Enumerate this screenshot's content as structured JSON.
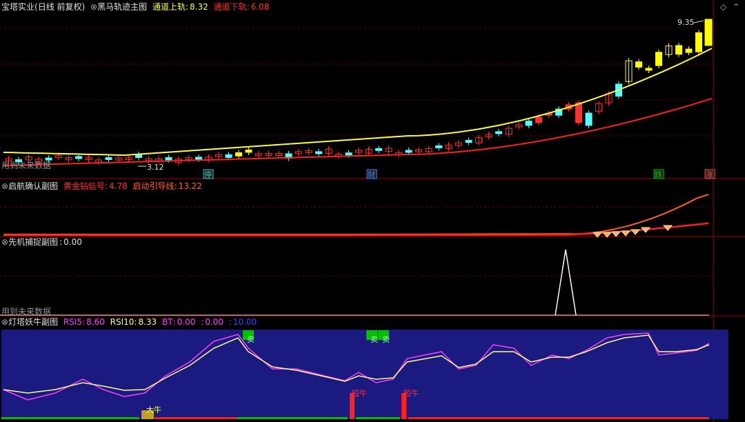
{
  "main_panel": {
    "stock_name": "宝塔实业",
    "period": "(日线 前复权)",
    "indicator_name": "黑马轨迹主图",
    "upper_label": "通道上轨",
    "upper_value": "8.32",
    "lower_label": "通道下轨",
    "lower_value": "6.08",
    "high_label": "9.35",
    "low_label": "3.12",
    "future_data_note": "用到未来数据",
    "markers": [
      {
        "text": "停",
        "color": "#40c0c0"
      },
      {
        "text": "财",
        "color": "#4080ff"
      },
      {
        "text": "跌",
        "color": "#00c000"
      },
      {
        "text": "涨",
        "color": "#ff4040"
      }
    ]
  },
  "panel2": {
    "title": "启航确认副图",
    "gold_label": "黄金钻信号",
    "gold_value": "4.78",
    "guide_label": "启动引导线",
    "guide_value": "13.22"
  },
  "panel3": {
    "title": "先机捕捉副图",
    "value": "0.00",
    "future_data_note": "用到未来数据"
  },
  "panel4": {
    "title": "灯塔妖牛副图",
    "rsi5_label": "RSI5",
    "rsi5_value": "8.60",
    "rsi10_label": "RSI10",
    "rsi10_value": "8.33",
    "bt_label": "BT",
    "bt_value": "0.00",
    "extra_value_1": "0.00",
    "extra_value_2": "10.00",
    "sell_labels": [
      "卖",
      "卖",
      "卖"
    ],
    "bull_labels": [
      "大牛",
      "短牛",
      "短牛"
    ]
  },
  "colors": {
    "up_red": "#ff3030",
    "down_cyan": "#54ffff",
    "yellow_up": "#ffff00",
    "upper_line": "#ffff40",
    "lower_line": "#ff2020",
    "rsi_bg": "#1a1a80",
    "rsi5": "#ff40ff",
    "rsi10": "#ffff80"
  },
  "chart_data": {
    "type": "candlestick",
    "series": [
      {
        "name": "通道上轨",
        "last": 8.32
      },
      {
        "name": "通道下轨",
        "last": 6.08
      }
    ],
    "annotations": {
      "high": 9.35,
      "low": 3.12
    }
  }
}
